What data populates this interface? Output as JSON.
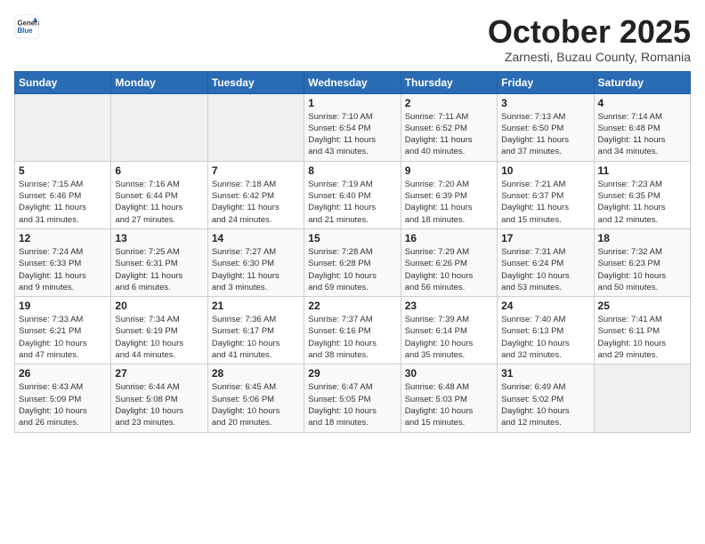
{
  "logo": {
    "general": "General",
    "blue": "Blue"
  },
  "header": {
    "title": "October 2025",
    "subtitle": "Zarnesti, Buzau County, Romania"
  },
  "weekdays": [
    "Sunday",
    "Monday",
    "Tuesday",
    "Wednesday",
    "Thursday",
    "Friday",
    "Saturday"
  ],
  "weeks": [
    [
      {
        "day": "",
        "info": ""
      },
      {
        "day": "",
        "info": ""
      },
      {
        "day": "",
        "info": ""
      },
      {
        "day": "1",
        "info": "Sunrise: 7:10 AM\nSunset: 6:54 PM\nDaylight: 11 hours\nand 43 minutes."
      },
      {
        "day": "2",
        "info": "Sunrise: 7:11 AM\nSunset: 6:52 PM\nDaylight: 11 hours\nand 40 minutes."
      },
      {
        "day": "3",
        "info": "Sunrise: 7:13 AM\nSunset: 6:50 PM\nDaylight: 11 hours\nand 37 minutes."
      },
      {
        "day": "4",
        "info": "Sunrise: 7:14 AM\nSunset: 6:48 PM\nDaylight: 11 hours\nand 34 minutes."
      }
    ],
    [
      {
        "day": "5",
        "info": "Sunrise: 7:15 AM\nSunset: 6:46 PM\nDaylight: 11 hours\nand 31 minutes."
      },
      {
        "day": "6",
        "info": "Sunrise: 7:16 AM\nSunset: 6:44 PM\nDaylight: 11 hours\nand 27 minutes."
      },
      {
        "day": "7",
        "info": "Sunrise: 7:18 AM\nSunset: 6:42 PM\nDaylight: 11 hours\nand 24 minutes."
      },
      {
        "day": "8",
        "info": "Sunrise: 7:19 AM\nSunset: 6:40 PM\nDaylight: 11 hours\nand 21 minutes."
      },
      {
        "day": "9",
        "info": "Sunrise: 7:20 AM\nSunset: 6:39 PM\nDaylight: 11 hours\nand 18 minutes."
      },
      {
        "day": "10",
        "info": "Sunrise: 7:21 AM\nSunset: 6:37 PM\nDaylight: 11 hours\nand 15 minutes."
      },
      {
        "day": "11",
        "info": "Sunrise: 7:23 AM\nSunset: 6:35 PM\nDaylight: 11 hours\nand 12 minutes."
      }
    ],
    [
      {
        "day": "12",
        "info": "Sunrise: 7:24 AM\nSunset: 6:33 PM\nDaylight: 11 hours\nand 9 minutes."
      },
      {
        "day": "13",
        "info": "Sunrise: 7:25 AM\nSunset: 6:31 PM\nDaylight: 11 hours\nand 6 minutes."
      },
      {
        "day": "14",
        "info": "Sunrise: 7:27 AM\nSunset: 6:30 PM\nDaylight: 11 hours\nand 3 minutes."
      },
      {
        "day": "15",
        "info": "Sunrise: 7:28 AM\nSunset: 6:28 PM\nDaylight: 10 hours\nand 59 minutes."
      },
      {
        "day": "16",
        "info": "Sunrise: 7:29 AM\nSunset: 6:26 PM\nDaylight: 10 hours\nand 56 minutes."
      },
      {
        "day": "17",
        "info": "Sunrise: 7:31 AM\nSunset: 6:24 PM\nDaylight: 10 hours\nand 53 minutes."
      },
      {
        "day": "18",
        "info": "Sunrise: 7:32 AM\nSunset: 6:23 PM\nDaylight: 10 hours\nand 50 minutes."
      }
    ],
    [
      {
        "day": "19",
        "info": "Sunrise: 7:33 AM\nSunset: 6:21 PM\nDaylight: 10 hours\nand 47 minutes."
      },
      {
        "day": "20",
        "info": "Sunrise: 7:34 AM\nSunset: 6:19 PM\nDaylight: 10 hours\nand 44 minutes."
      },
      {
        "day": "21",
        "info": "Sunrise: 7:36 AM\nSunset: 6:17 PM\nDaylight: 10 hours\nand 41 minutes."
      },
      {
        "day": "22",
        "info": "Sunrise: 7:37 AM\nSunset: 6:16 PM\nDaylight: 10 hours\nand 38 minutes."
      },
      {
        "day": "23",
        "info": "Sunrise: 7:39 AM\nSunset: 6:14 PM\nDaylight: 10 hours\nand 35 minutes."
      },
      {
        "day": "24",
        "info": "Sunrise: 7:40 AM\nSunset: 6:13 PM\nDaylight: 10 hours\nand 32 minutes."
      },
      {
        "day": "25",
        "info": "Sunrise: 7:41 AM\nSunset: 6:11 PM\nDaylight: 10 hours\nand 29 minutes."
      }
    ],
    [
      {
        "day": "26",
        "info": "Sunrise: 6:43 AM\nSunset: 5:09 PM\nDaylight: 10 hours\nand 26 minutes."
      },
      {
        "day": "27",
        "info": "Sunrise: 6:44 AM\nSunset: 5:08 PM\nDaylight: 10 hours\nand 23 minutes."
      },
      {
        "day": "28",
        "info": "Sunrise: 6:45 AM\nSunset: 5:06 PM\nDaylight: 10 hours\nand 20 minutes."
      },
      {
        "day": "29",
        "info": "Sunrise: 6:47 AM\nSunset: 5:05 PM\nDaylight: 10 hours\nand 18 minutes."
      },
      {
        "day": "30",
        "info": "Sunrise: 6:48 AM\nSunset: 5:03 PM\nDaylight: 10 hours\nand 15 minutes."
      },
      {
        "day": "31",
        "info": "Sunrise: 6:49 AM\nSunset: 5:02 PM\nDaylight: 10 hours\nand 12 minutes."
      },
      {
        "day": "",
        "info": ""
      }
    ]
  ]
}
